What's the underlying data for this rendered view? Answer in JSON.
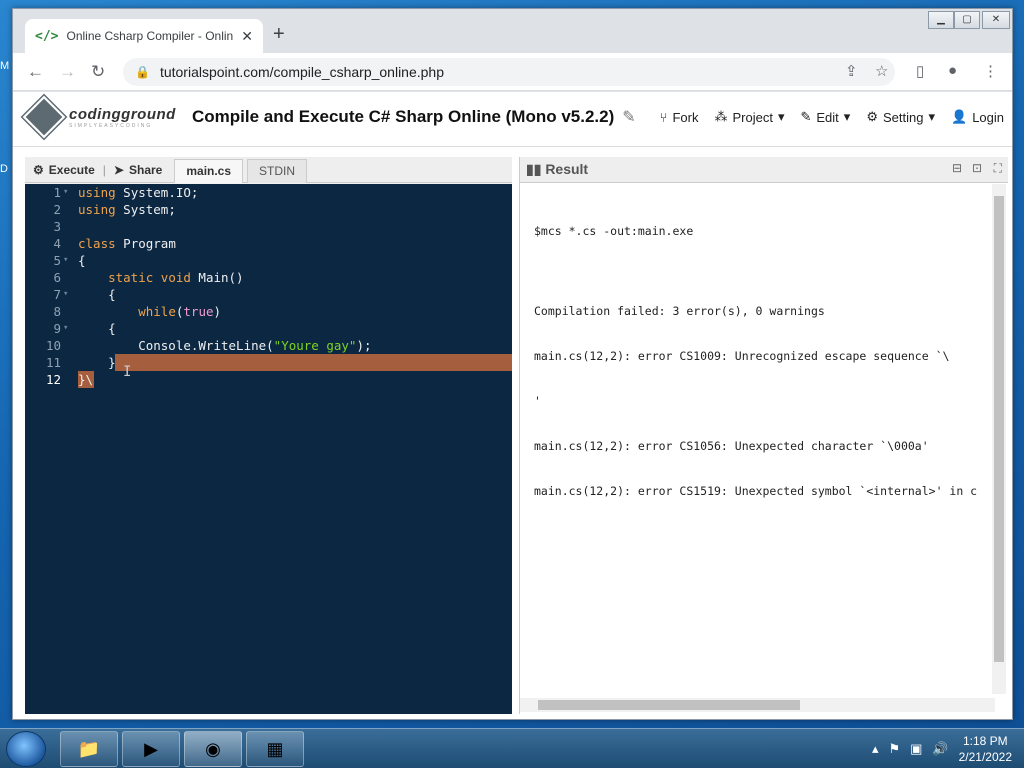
{
  "browser": {
    "tab_title": "Online Csharp Compiler - Online",
    "url": "tutorialspoint.com/compile_csharp_online.php"
  },
  "site": {
    "logo_text": "codingground",
    "logo_sub": "SIMPLYEASYCODING",
    "title": "Compile and Execute C# Sharp Online (Mono v5.2.2)",
    "menu": [
      {
        "label": "Fork",
        "icon": "fork-icon"
      },
      {
        "label": "Project",
        "icon": "project-icon"
      },
      {
        "label": "Edit",
        "icon": "edit-icon"
      },
      {
        "label": "Setting",
        "icon": "gear-icon"
      },
      {
        "label": "Login",
        "icon": "user-icon"
      }
    ]
  },
  "editor": {
    "execute_label": "Execute",
    "share_label": "Share",
    "tabs": [
      "main.cs",
      "STDIN"
    ],
    "line_numbers": [
      "1",
      "2",
      "3",
      "4",
      "5",
      "6",
      "7",
      "8",
      "9",
      "10",
      "11",
      "12"
    ]
  },
  "result": {
    "label": "Result",
    "output": [
      "$mcs *.cs -out:main.exe",
      "",
      "Compilation failed: 3 error(s), 0 warnings",
      "main.cs(12,2): error CS1009: Unrecognized escape sequence `\\",
      "'",
      "main.cs(12,2): error CS1056: Unexpected character `\\000a'",
      "main.cs(12,2): error CS1519: Unexpected symbol `<internal>' in c"
    ]
  },
  "taskbar": {
    "time": "1:18 PM",
    "date": "2/21/2022"
  }
}
